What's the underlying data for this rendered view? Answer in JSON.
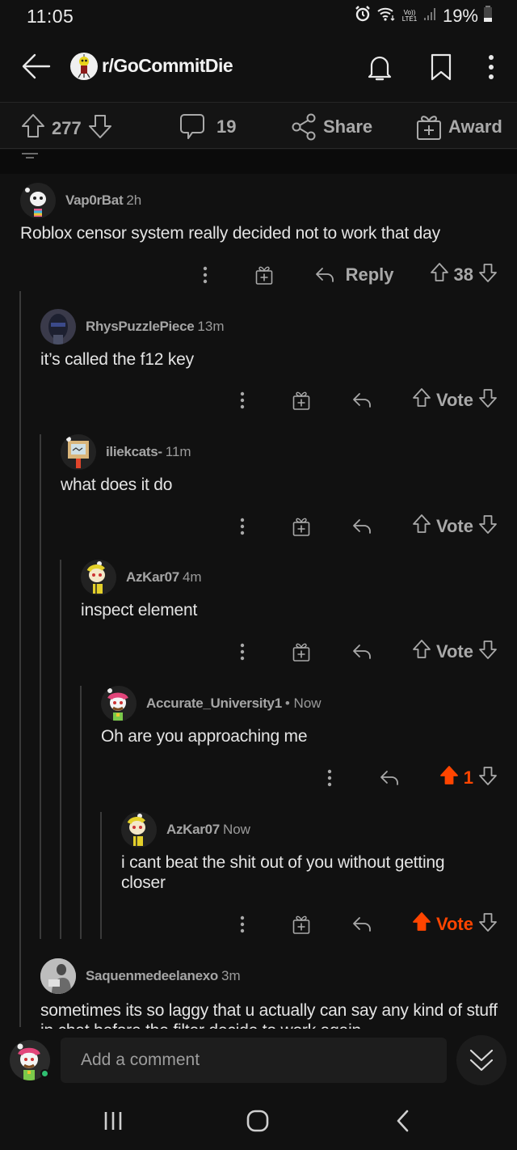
{
  "status_bar": {
    "time": "11:05",
    "network_top": "Vo))",
    "network_bottom": "LTE1",
    "battery_percent": "19%",
    "icons": [
      "alarm-icon",
      "wifi-icon",
      "signal-icon",
      "battery-icon"
    ]
  },
  "header": {
    "subreddit": "r/GoCommitDie",
    "icons": [
      "back-arrow-icon",
      "bell-icon",
      "bookmark-icon",
      "more-vertical-icon"
    ]
  },
  "post_actions": {
    "score": "277",
    "comments": "19",
    "share_label": "Share",
    "award_label": "Award"
  },
  "comments": [
    {
      "username": "Vap0rBat",
      "time": "2h",
      "body": "Roblox censor system really decided not to work that day",
      "reply_label": "Reply",
      "score": "38",
      "upvoted": false,
      "show_award": true
    },
    {
      "username": "RhysPuzzlePiece",
      "time": "13m",
      "body": "it’s called the f12 key",
      "score": "Vote",
      "upvoted": false,
      "show_award": true
    },
    {
      "username": "iliekcats-",
      "time": "11m",
      "body": "what does it do",
      "score": "Vote",
      "upvoted": false,
      "show_award": true
    },
    {
      "username": "AzKar07",
      "time": "4m",
      "body": "inspect element",
      "score": "Vote",
      "upvoted": false,
      "show_award": true
    },
    {
      "username": "Accurate_University1",
      "time": "• Now",
      "body": "Oh are you approaching me",
      "score": "1",
      "upvoted": true,
      "show_award": false
    },
    {
      "username": "AzKar07",
      "time": "Now",
      "body": "i cant beat the shit out of you without getting closer",
      "score": "Vote",
      "upvoted": true,
      "show_award": true
    },
    {
      "username": "Saquenmedeelanexo",
      "time": "3m",
      "body": "sometimes its so laggy that u actually can say any kind of stuff in chat before the filter decide to work again"
    }
  ],
  "comment_bar": {
    "placeholder": "Add a comment"
  },
  "colors": {
    "background": "#111111",
    "upvote_active": "#ff4500",
    "muted_text": "#a9a9a9",
    "online": "#2fbf71"
  }
}
